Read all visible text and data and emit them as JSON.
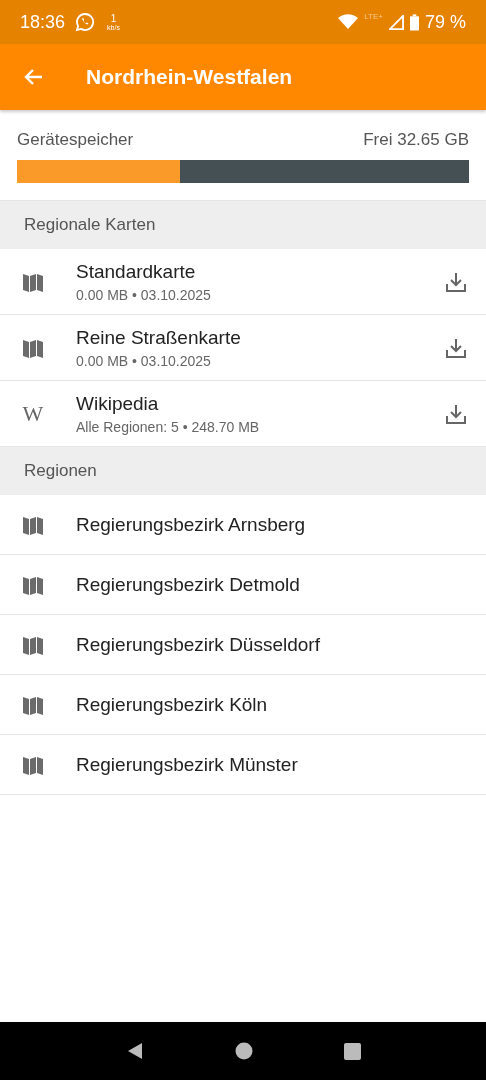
{
  "status_bar": {
    "time": "18:36",
    "speed_value": "1",
    "speed_unit": "kb/s",
    "network": "LTE+",
    "battery": "79 %"
  },
  "app_bar": {
    "title": "Nordrhein-Westfalen"
  },
  "storage": {
    "label": "Gerätespeicher",
    "free": "Frei 32.65 GB",
    "level": 0.36
  },
  "sections": [
    {
      "title": "Regionale Karten",
      "items": [
        {
          "kind": "map",
          "title": "Standardkarte",
          "subtitle": "0.00 MB • 03.10.2025",
          "download": true
        },
        {
          "kind": "map",
          "title": "Reine Straßenkarte",
          "subtitle": "0.00 MB • 03.10.2025",
          "download": true
        },
        {
          "kind": "wiki",
          "glyph": "W",
          "title": "Wikipedia",
          "subtitle": "Alle Regionen: 5 • 248.70 MB",
          "download": true
        }
      ]
    },
    {
      "title": "Regionen",
      "items": [
        {
          "kind": "map",
          "title": "Regierungsbezirk Arnsberg"
        },
        {
          "kind": "map",
          "title": "Regierungsbezirk Detmold"
        },
        {
          "kind": "map",
          "title": "Regierungsbezirk Düsseldorf"
        },
        {
          "kind": "map",
          "title": "Regierungsbezirk Köln"
        },
        {
          "kind": "map",
          "title": "Regierungsbezirk Münster"
        }
      ]
    }
  ]
}
